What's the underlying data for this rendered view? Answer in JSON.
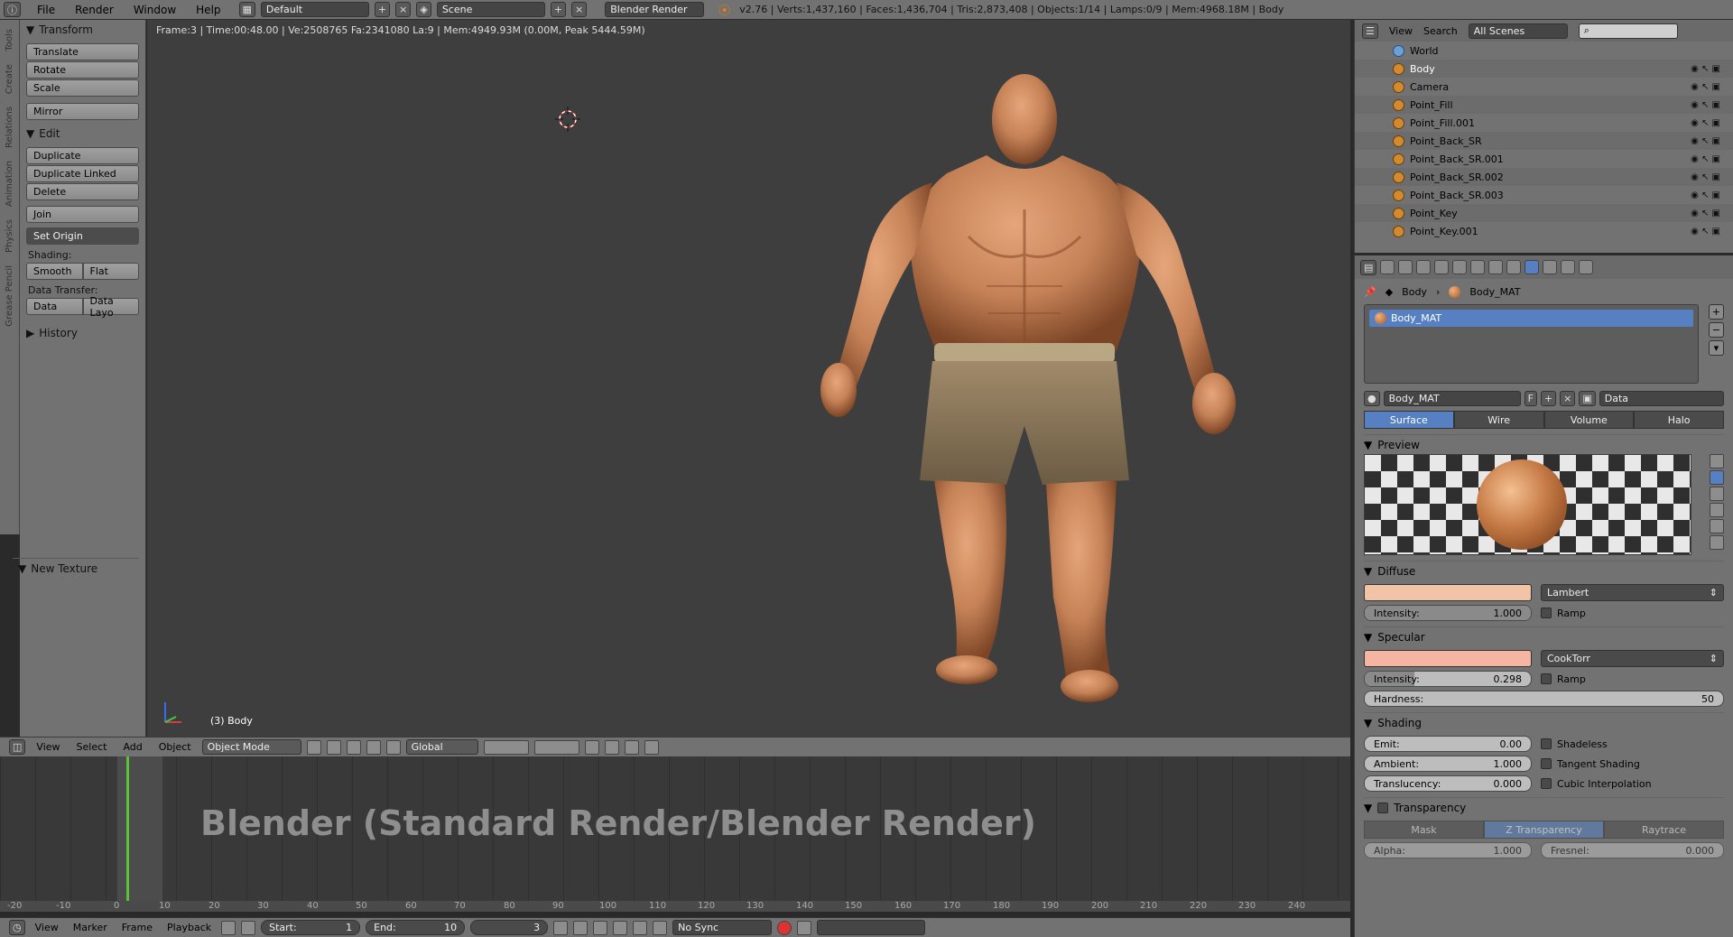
{
  "topbar": {
    "menu": [
      "File",
      "Render",
      "Window",
      "Help"
    ],
    "screen_layout": "Default",
    "scene": "Scene",
    "engine": "Blender Render",
    "stats": "v2.76 | Verts:1,437,160 | Faces:1,436,704 | Tris:2,873,408 | Objects:1/14 | Lamps:0/9 | Mem:4968.18M | Body"
  },
  "tabs": [
    "Tools",
    "Create",
    "Relations",
    "Animation",
    "Physics",
    "Grease Pencil"
  ],
  "toolshelf": {
    "transform_title": "Transform",
    "transform_buttons": [
      "Translate",
      "Rotate",
      "Scale"
    ],
    "mirror": "Mirror",
    "edit_title": "Edit",
    "edit_buttons": [
      "Duplicate",
      "Duplicate Linked",
      "Delete"
    ],
    "join": "Join",
    "set_origin": "Set Origin",
    "shading_label": "Shading:",
    "shading_buttons": [
      "Smooth",
      "Flat"
    ],
    "data_transfer_label": "Data Transfer:",
    "data_transfer_buttons": [
      "Data",
      "Data Layo"
    ],
    "history_title": "History",
    "new_texture_title": "New Texture"
  },
  "viewport": {
    "info": "Frame:3 | Time:00:48.00 | Ve:2508765 Fa:2341080 La:9 | Mem:4949.93M (0.00M, Peak 5444.59M)",
    "object_label": "(3) Body"
  },
  "vp_header": {
    "menus": [
      "View",
      "Select",
      "Add",
      "Object"
    ],
    "mode": "Object Mode",
    "orientation": "Global"
  },
  "timeline": {
    "watermark": "Blender (Standard Render/Blender Render)",
    "ticks": [
      "-20",
      "-10",
      "0",
      "10",
      "20",
      "30",
      "40",
      "50",
      "60",
      "70",
      "80",
      "90",
      "100",
      "110",
      "120",
      "130",
      "140",
      "150",
      "160",
      "170",
      "180",
      "190",
      "200",
      "210",
      "220",
      "230",
      "240"
    ],
    "footer_menus": [
      "View",
      "Marker",
      "Frame",
      "Playback"
    ],
    "start_label": "Start:",
    "start_value": "1",
    "end_label": "End:",
    "end_value": "10",
    "current_frame": "3",
    "sync": "No Sync"
  },
  "outliner": {
    "menus": [
      "View",
      "Search"
    ],
    "filter": "All Scenes",
    "items": [
      "World",
      "Body",
      "Camera",
      "Point_Fill",
      "Point_Fill.001",
      "Point_Back_SR",
      "Point_Back_SR.001",
      "Point_Back_SR.002",
      "Point_Back_SR.003",
      "Point_Key",
      "Point_Key.001"
    ]
  },
  "properties": {
    "crumb_object": "Body",
    "crumb_material": "Body_MAT",
    "material_slot": "Body_MAT",
    "material_name": "Body_MAT",
    "fake_user": "F",
    "link": "Data",
    "type_tabs": [
      "Surface",
      "Wire",
      "Volume",
      "Halo"
    ],
    "preview_title": "Preview",
    "diffuse_title": "Diffuse",
    "diffuse_color": "#f2c3a7",
    "diffuse_shader": "Lambert",
    "diffuse_intensity_label": "Intensity:",
    "diffuse_intensity": "1.000",
    "ramp_label": "Ramp",
    "specular_title": "Specular",
    "specular_color": "#f6b4a2",
    "specular_shader": "CookTorr",
    "specular_intensity_label": "Intensity:",
    "specular_intensity": "0.298",
    "specular_ramp_label": "Ramp",
    "hardness_label": "Hardness:",
    "hardness": "50",
    "shading_title": "Shading",
    "emit_label": "Emit:",
    "emit": "0.00",
    "ambient_label": "Ambient:",
    "ambient": "1.000",
    "translucency_label": "Translucency:",
    "translucency": "0.000",
    "shadeless_label": "Shadeless",
    "tangent_label": "Tangent Shading",
    "cubic_label": "Cubic Interpolation",
    "transparency_title": "Transparency",
    "transparency_modes": [
      "Mask",
      "Z Transparency",
      "Raytrace"
    ],
    "alpha_label": "Alpha:",
    "alpha": "1.000",
    "fresnel_label": "Fresnel:",
    "fresnel": "0.000"
  }
}
